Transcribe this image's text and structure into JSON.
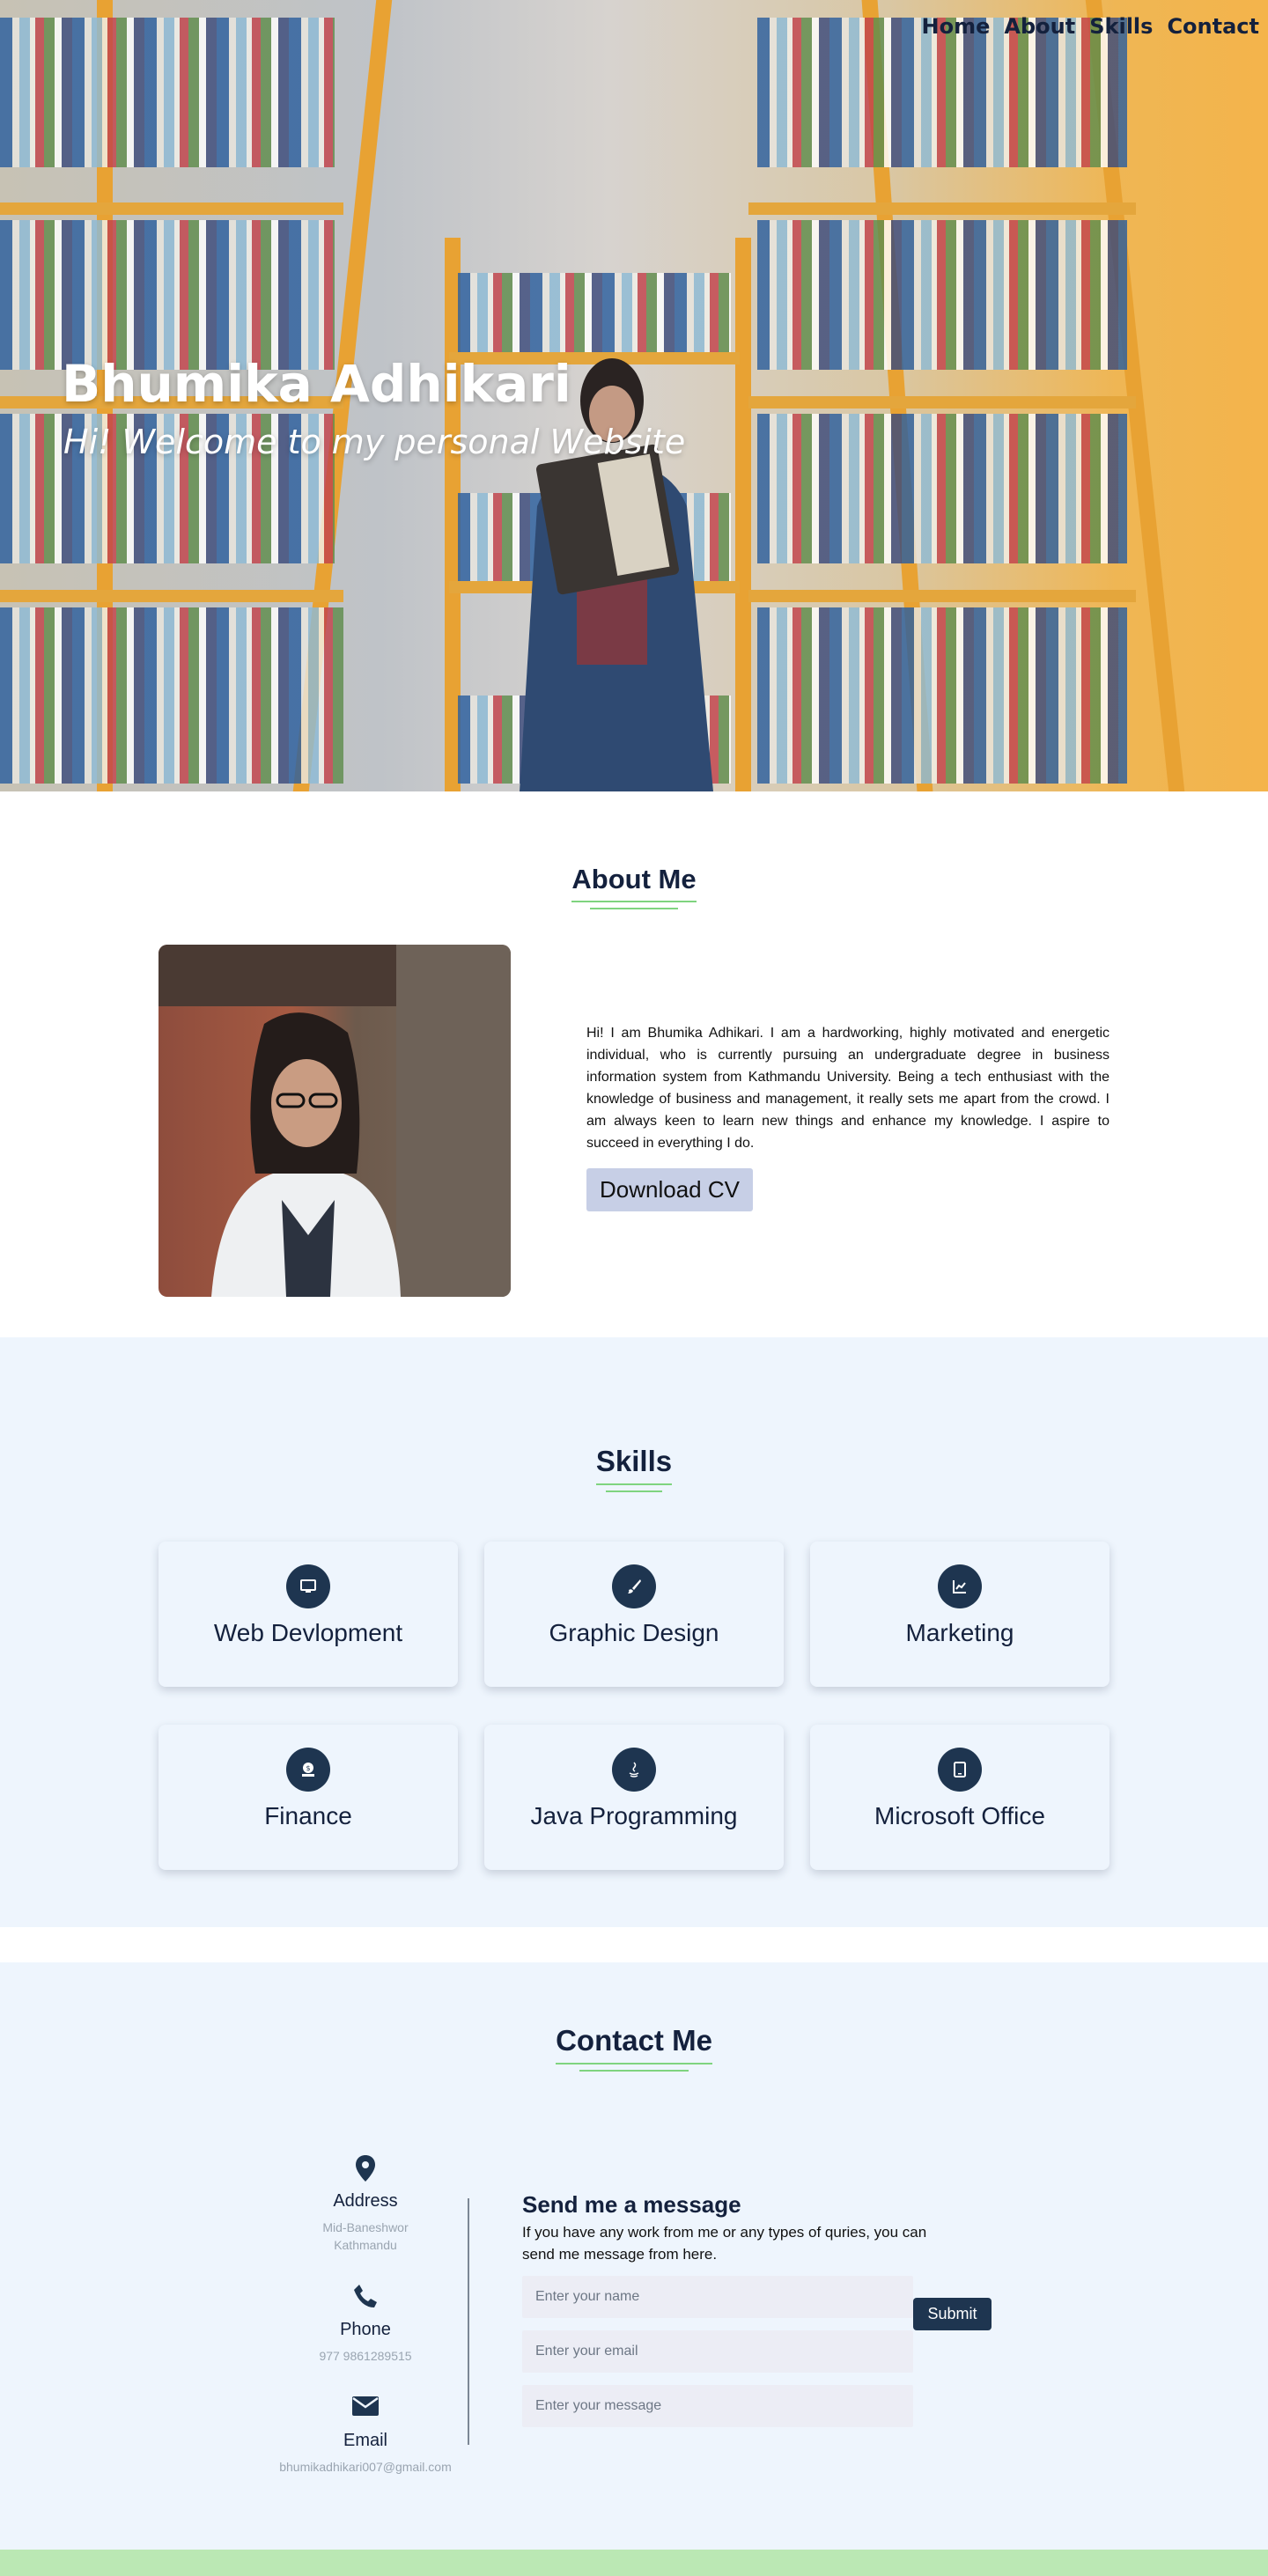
{
  "nav": {
    "items": [
      {
        "label": "Home"
      },
      {
        "label": "About"
      },
      {
        "label": "Skills"
      },
      {
        "label": "Contact"
      }
    ]
  },
  "hero": {
    "name": "Bhumika Adhikari",
    "subtitle": "Hi! Welcome to my personal Website"
  },
  "about": {
    "title": "About Me",
    "text": "Hi! I am Bhumika Adhikari. I am a hardworking, highly motivated and energetic individual, who is currently pursuing an undergraduate degree in business information system from Kathmandu University. Being a tech enthusiast with the knowledge of business and management, it really sets me apart from the crowd. I am always keen to learn new things and enhance my knowledge. I aspire to succeed in everything I do.",
    "cv_button": "Download CV"
  },
  "skills": {
    "title": "Skills",
    "items": [
      {
        "label": "Web Devlopment",
        "icon": "desktop-icon"
      },
      {
        "label": "Graphic Design",
        "icon": "brush-icon"
      },
      {
        "label": "Marketing",
        "icon": "chart-icon"
      },
      {
        "label": "Finance",
        "icon": "money-icon"
      },
      {
        "label": "Java Programming",
        "icon": "java-icon"
      },
      {
        "label": "Microsoft Office",
        "icon": "tablet-icon"
      }
    ]
  },
  "contact": {
    "title": "Contact Me",
    "address": {
      "title": "Address",
      "line1": "Mid-Baneshwor",
      "line2": "Kathmandu"
    },
    "phone": {
      "title": "Phone",
      "value": "977 9861289515"
    },
    "email": {
      "title": "Email",
      "value": "bhumikadhikari007@gmail.com"
    },
    "form": {
      "title": "Send me a message",
      "description": "If you have any work from me or any types of quries, you can send me message from here.",
      "name_placeholder": "Enter your name",
      "email_placeholder": "Enter your email",
      "message_placeholder": "Enter your message",
      "submit": "Submit"
    }
  },
  "colors": {
    "navy": "#1e3550",
    "accent_green": "#7fd47f",
    "section_bg": "#eef5fd",
    "footer": "#bbe8b4",
    "cv_button": "#c7cfe6"
  }
}
